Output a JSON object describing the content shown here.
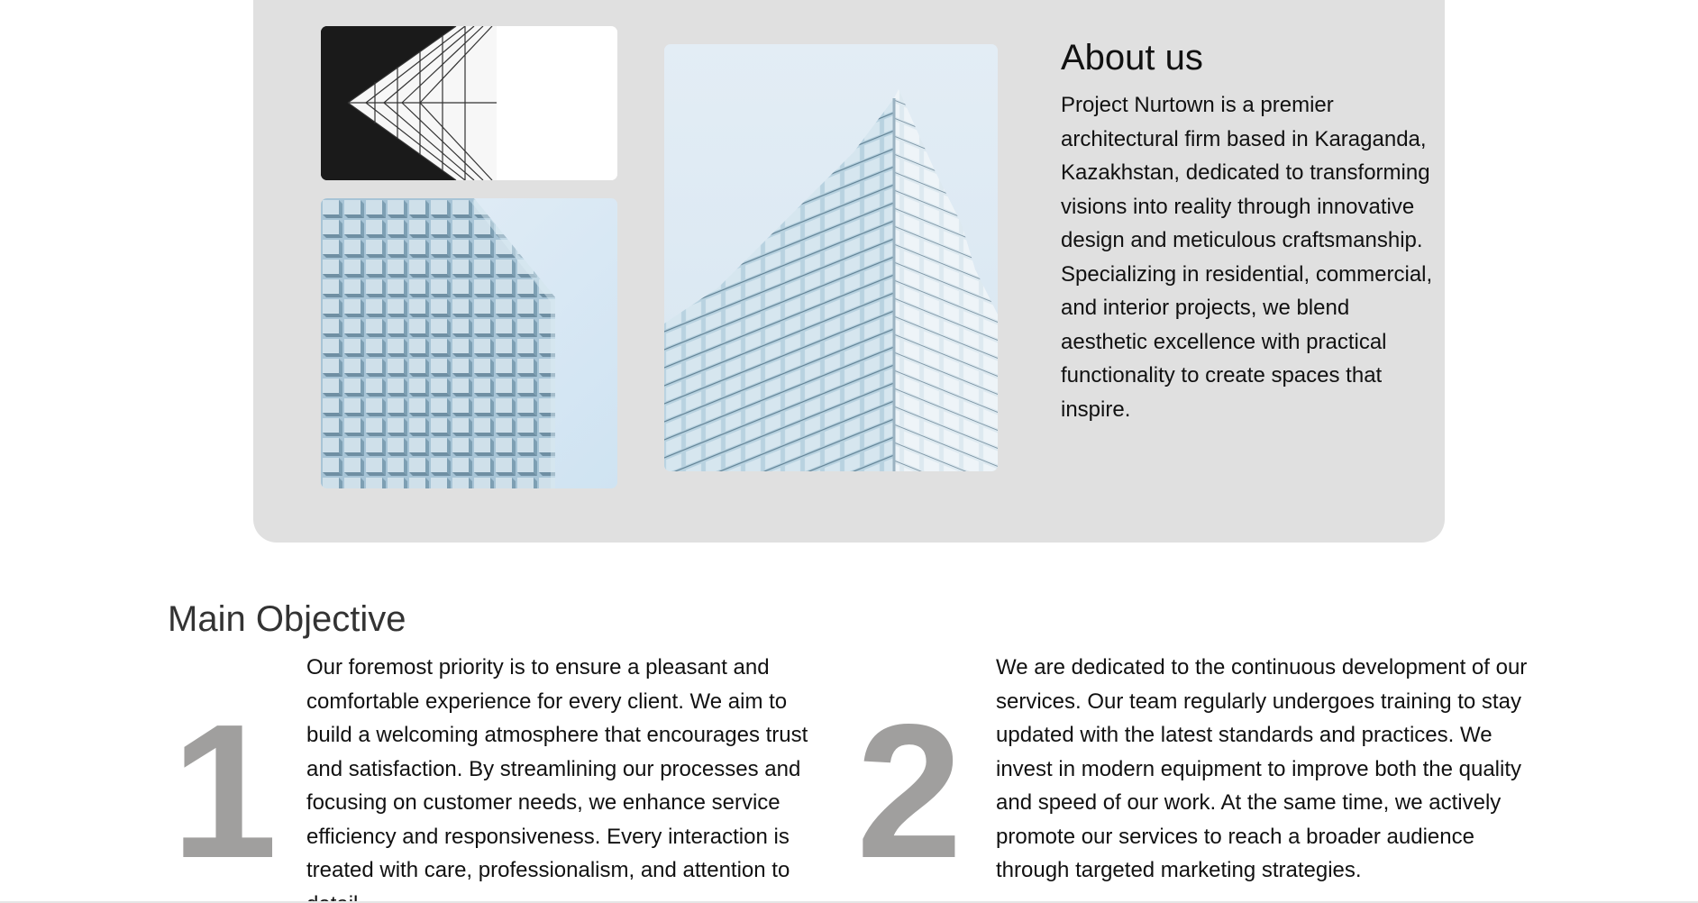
{
  "about": {
    "title": "About us",
    "body": "Project Nurtown is a premier architectural firm based in Karaganda, Kazakhstan, dedicated to transforming visions into reality through innovative design and meticulous craftsmanship. Specializing in residential, commercial, and interior projects, we blend aesthetic excellence with practical functionality to create spaces that inspire."
  },
  "objective": {
    "title": "Main Objective",
    "items": [
      {
        "number": "1",
        "text": "Our foremost priority is to ensure a pleasant and comfortable experience for every client. We aim to build a welcoming atmosphere that encourages trust and satisfaction. By streamlining our processes and focusing on customer needs, we enhance service efficiency and responsiveness. Every interaction is treated with care, professionalism, and attention to detail."
      },
      {
        "number": "2",
        "text": "We are dedicated to the continuous development of our services. Our team regularly undergoes training to stay updated with the latest standards and practices. We invest in modern equipment to improve both the quality and speed of our work. At the same time, we actively promote our services to reach a broader audience through targeted marketing strategies."
      }
    ]
  },
  "colors": {
    "panel_background": "#e0e0e0",
    "number_color": "#a09f9e",
    "heading_color": "#333333"
  }
}
